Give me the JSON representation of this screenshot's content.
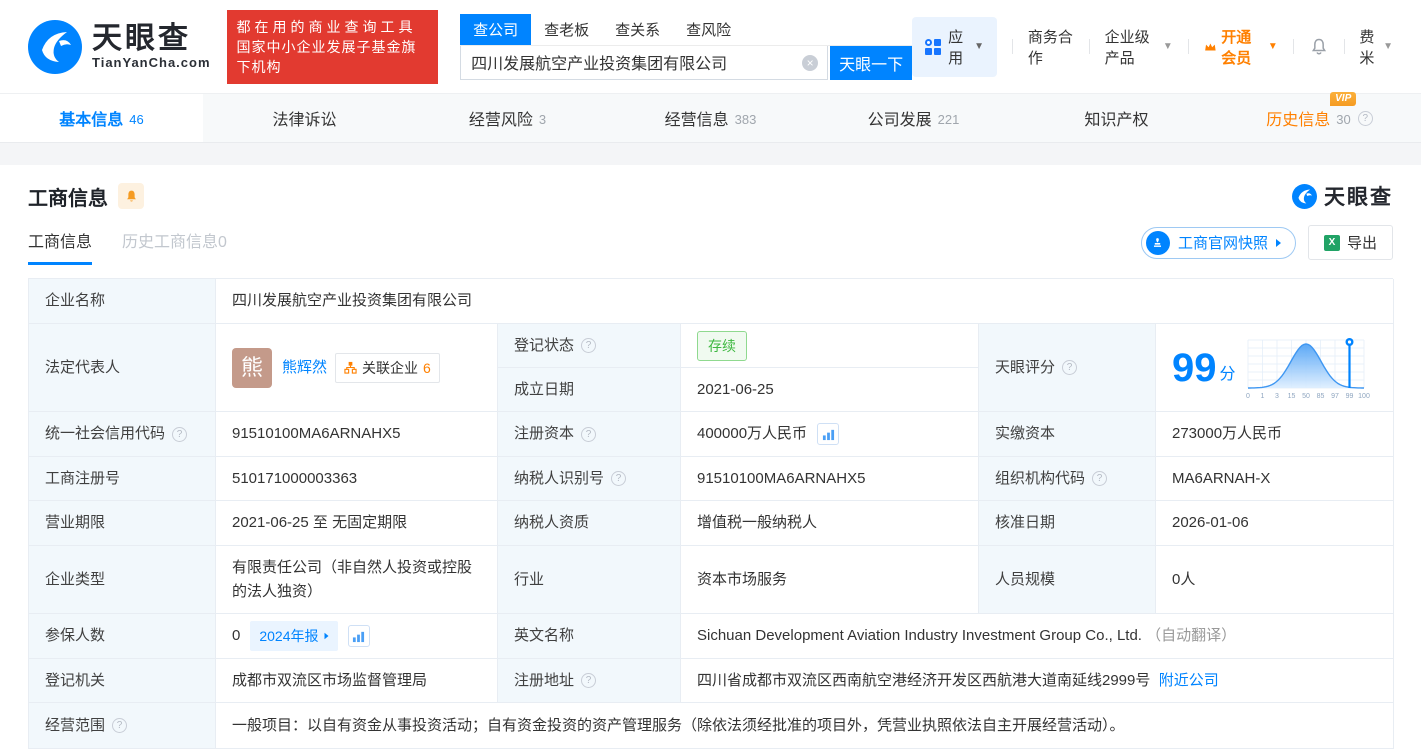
{
  "brand": {
    "name": "天眼查",
    "domain": "TianYanCha.com",
    "slogan1": "都在用的商业查询工具",
    "slogan2": "国家中小企业发展子基金旗下机构"
  },
  "search": {
    "tabs": [
      "查公司",
      "查老板",
      "查关系",
      "查风险"
    ],
    "active_index": 0,
    "value": "四川发展航空产业投资集团有限公司",
    "button": "天眼一下"
  },
  "top_menu": {
    "apps": "应用",
    "coop": "商务合作",
    "enterprise": "企业级产品",
    "vip": "开通会员",
    "user": "费米"
  },
  "vip_badge_text": "VIP",
  "nav_tabs": [
    {
      "label": "基本信息",
      "count": "46",
      "active": true
    },
    {
      "label": "法律诉讼",
      "count": ""
    },
    {
      "label": "经营风险",
      "count": "3"
    },
    {
      "label": "经营信息",
      "count": "383"
    },
    {
      "label": "公司发展",
      "count": "221"
    },
    {
      "label": "知识产权",
      "count": ""
    },
    {
      "label": "历史信息",
      "count": "30",
      "vip": true,
      "help": true
    }
  ],
  "section": {
    "title": "工商信息",
    "tab_current": "工商信息",
    "tab_history": "历史工商信息0",
    "snapshot_button": "工商官网快照",
    "export_button": "导出",
    "watermark": "天眼查"
  },
  "fields": {
    "company_name_label": "企业名称",
    "company_name": "四川发展航空产业投资集团有限公司",
    "legal_rep_label": "法定代表人",
    "legal_rep_avatar": "熊",
    "legal_rep_name": "熊辉然",
    "related_label": "关联企业",
    "related_count": "6",
    "reg_status_label": "登记状态",
    "reg_status": "存续",
    "establish_label": "成立日期",
    "establish_date": "2021-06-25",
    "score_label": "天眼评分",
    "score": "99",
    "score_unit": "分",
    "credit_code_label": "统一社会信用代码",
    "credit_code": "91510100MA6ARNAHX5",
    "reg_capital_label": "注册资本",
    "reg_capital": "400000万人民币",
    "paid_capital_label": "实缴资本",
    "paid_capital": "273000万人民币",
    "reg_number_label": "工商注册号",
    "reg_number": "510171000003363",
    "taxpayer_id_label": "纳税人识别号",
    "taxpayer_id": "91510100MA6ARNAHX5",
    "org_code_label": "组织机构代码",
    "org_code": "MA6ARNAH-X",
    "term_label": "营业期限",
    "term": "2021-06-25 至 无固定期限",
    "taxpayer_quality_label": "纳税人资质",
    "taxpayer_quality": "增值税一般纳税人",
    "approval_date_label": "核准日期",
    "approval_date": "2026-01-06",
    "company_type_label": "企业类型",
    "company_type": "有限责任公司（非自然人投资或控股的法人独资）",
    "industry_label": "行业",
    "industry": "资本市场服务",
    "staff_size_label": "人员规模",
    "staff_size": "0人",
    "insured_label": "参保人数",
    "insured_count": "0",
    "annual_report": "2024年报",
    "english_name_label": "英文名称",
    "english_name": "Sichuan Development Aviation Industry Investment Group Co., Ltd.",
    "english_name_note": "（自动翻译）",
    "registry_label": "登记机关",
    "registry": "成都市双流区市场监督管理局",
    "address_label": "注册地址",
    "address": "四川省成都市双流区西南航空港经济开发区西航港大道南延线2999号",
    "nearby_link": "附近公司",
    "scope_label": "经营范围",
    "scope": "一般项目：以自有资金从事投资活动；自有资金投资的资产管理服务（除依法须经批准的项目外，凭营业执照依法自主开展经营活动）。"
  },
  "chart_data": {
    "type": "area",
    "title": "天眼评分",
    "score": 99,
    "ticks": [
      "0",
      "1",
      "3",
      "15",
      "50",
      "85",
      "97",
      "99",
      "100"
    ],
    "marker_tick": "99",
    "curve": "bell-distribution"
  },
  "colors": {
    "accent": "#0084ff",
    "orange": "#ff8000",
    "red": "#e23a30",
    "green": "#3eb841"
  }
}
